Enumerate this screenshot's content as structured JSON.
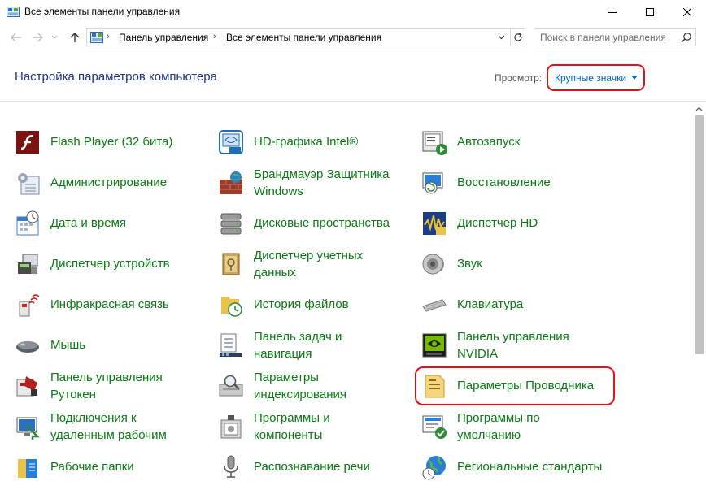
{
  "window": {
    "title": "Все элементы панели управления",
    "controls": {
      "minimize": "minimize",
      "maximize": "maximize",
      "close": "close"
    }
  },
  "address": {
    "crumbs": [
      "Панель управления",
      "Все элементы панели управления"
    ],
    "separator": "›"
  },
  "search": {
    "placeholder": "Поиск в панели управления"
  },
  "header": {
    "title": "Настройка параметров компьютера",
    "view_label": "Просмотр:",
    "view_value": "Крупные значки"
  },
  "items": [
    {
      "label": "Flash Player (32 бита)",
      "icon": "flash-player-icon",
      "color": "#8b1a1a"
    },
    {
      "label": "HD-графика Intel®",
      "icon": "intel-graphics-icon",
      "color": "#1d6fb8"
    },
    {
      "label": "Автозапуск",
      "icon": "autoplay-icon",
      "color": "#2e8b3a"
    },
    {
      "label": "Администрирование",
      "icon": "administration-icon",
      "color": "#7a8a99"
    },
    {
      "label": "Брандмауэр Защитника Windows",
      "icon": "firewall-icon",
      "color": "#9c3b2a"
    },
    {
      "label": "Восстановление",
      "icon": "recovery-icon",
      "color": "#2a7fd4"
    },
    {
      "label": "Дата и время",
      "icon": "date-time-icon",
      "color": "#3d7fc4"
    },
    {
      "label": "Дисковые пространства",
      "icon": "storage-spaces-icon",
      "color": "#8a8a8a"
    },
    {
      "label": "Диспетчер HD",
      "icon": "hd-audio-manager-icon",
      "color": "#1a3d8a"
    },
    {
      "label": "Диспетчер устройств",
      "icon": "device-manager-icon",
      "color": "#555555"
    },
    {
      "label": "Диспетчер учетных данных",
      "icon": "credential-manager-icon",
      "color": "#b08a3a"
    },
    {
      "label": "Звук",
      "icon": "sound-icon",
      "color": "#888888"
    },
    {
      "label": "Инфракрасная связь",
      "icon": "infrared-icon",
      "color": "#cc2222"
    },
    {
      "label": "История файлов",
      "icon": "file-history-icon",
      "color": "#e8c24a"
    },
    {
      "label": "Клавиатура",
      "icon": "keyboard-icon",
      "color": "#9a9a9a"
    },
    {
      "label": "Мышь",
      "icon": "mouse-icon",
      "color": "#555555"
    },
    {
      "label": "Панель задач и навигация",
      "icon": "taskbar-icon",
      "color": "#3b5a8a"
    },
    {
      "label": "Панель управления NVIDIA",
      "icon": "nvidia-icon",
      "color": "#76b900"
    },
    {
      "label": "Панель управления Рутокен",
      "icon": "rutoken-icon",
      "color": "#b22222"
    },
    {
      "label": "Параметры индексирования",
      "icon": "indexing-options-icon",
      "color": "#8a8a8a"
    },
    {
      "label": "Параметры Проводника",
      "icon": "explorer-options-icon",
      "color": "#e8c24a"
    },
    {
      "label": "Подключения к удаленным рабочим",
      "icon": "remote-desktop-icon",
      "color": "#2a6fc4"
    },
    {
      "label": "Программы и компоненты",
      "icon": "programs-features-icon",
      "color": "#8a8a8a"
    },
    {
      "label": "Программы по умолчанию",
      "icon": "default-programs-icon",
      "color": "#2e8b3a"
    },
    {
      "label": "Рабочие папки",
      "icon": "work-folders-icon",
      "color": "#2a7fd4"
    },
    {
      "label": "Распознавание речи",
      "icon": "speech-recognition-icon",
      "color": "#888888"
    },
    {
      "label": "Региональные стандарты",
      "icon": "region-icon",
      "color": "#2a7fd4"
    }
  ],
  "colors": {
    "link_green": "#0b7a15",
    "header_blue": "#1e3287",
    "link_blue": "#0066cc",
    "highlight_red": "#e2121b"
  }
}
